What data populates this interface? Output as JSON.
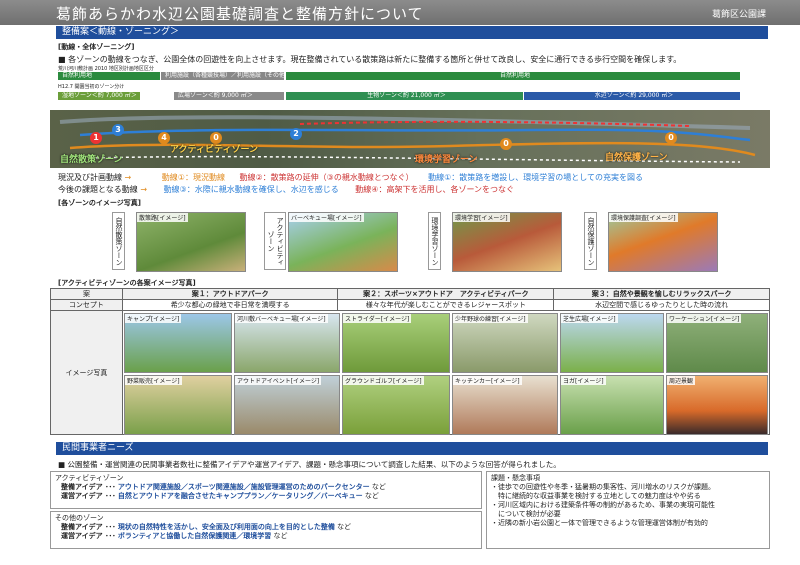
{
  "header": {
    "title": "葛飾あらかわ水辺公園基礎調査と整備方針について",
    "org": "葛飾区公園課"
  },
  "sec1": {
    "title": "整備案＜動線・ゾーニング＞",
    "sub": "[動線・全体ゾーニング]",
    "desc": "■ 各ゾーンの動線をつなぎ、公園全体の回遊性を向上させます。現在整備されている散策路は新たに整備する箇所と併せて改良し、安全に通行できる歩行空間を確保します。",
    "plan_label": "荒川河川敷計画 2010 地区別計画地区区分",
    "row1_a": "自然利用地",
    "row1_b": "利用施設（各種競技場）／利用施設（その他）",
    "row1_c": "自然利用地",
    "plan2": "H12.7 開園当初のゾーン分け",
    "zones": [
      {
        "label": "湿地ゾーン＜約 7,000 ㎡＞",
        "color": "#6b9e3a"
      },
      {
        "label": "広場ゾーン＜約 9,000 ㎡＞",
        "color": "#8a8a8a"
      },
      {
        "label": "生物ゾーン＜約 21,000 ㎡＞",
        "color": "#2f8f52"
      },
      {
        "label": "水辺ゾーン＜約 29,000 ㎡＞",
        "color": "#2a5aa8"
      }
    ],
    "map_zones": [
      "自然散策ゾーン",
      "アクティビティゾーン",
      "環境学習ゾーン",
      "自然保護ゾーン"
    ],
    "map_marks": [
      "1",
      "2",
      "3",
      "4",
      "0",
      "0",
      "0"
    ],
    "flow": {
      "l1a": "現況及び計画動線",
      "l1b": "→",
      "l1c": "動線①：現況動線",
      "l1d": "動線②：散策路の延伸（③の親水動線とつなぐ）",
      "l1e": "動線①：散策路を増設し、環境学習の場としての充実を図る",
      "l2a": "今後の課題となる動線",
      "l2c": "動線③：水際に親水動線を確保し、水辺を感じる",
      "l2d": "動線④：高架下を活用し、各ゾーンをつなぐ"
    }
  },
  "images": {
    "title": "[各ゾーンのイメージ写真]",
    "items": [
      {
        "zone": "自然散策ゾーン",
        "cap": "散策路[イメージ]"
      },
      {
        "zone": "アクティビティゾーン",
        "cap": "バーベキュー場[イメージ]"
      },
      {
        "zone": "環境学習ゾーン",
        "cap": "環境学習[イメージ]"
      },
      {
        "zone": "自然保護ゾーン",
        "cap": "環境保護調査[イメージ]"
      }
    ]
  },
  "activity": {
    "title": "[アクティビティゾーンの各案イメージ写真]",
    "h_an": "案",
    "h_concept": "コンセプト",
    "h_photo": "イメージ写真",
    "plans": [
      {
        "name": "案１：アウトドアパーク",
        "concept": "希少な都心の緑地で非日常を満喫する"
      },
      {
        "name": "案２：スポーツ×アウトドア　アクティビティパーク",
        "concept": "様々な年代が楽しむことができるレジャースポット"
      },
      {
        "name": "案３：自然や景観を愉しむリラックスパーク",
        "concept": "水辺空間で感じるゆったりとした時の流れ"
      }
    ],
    "photos": [
      "キャンプ[イメージ]",
      "河川敷バーベキュー場[イメージ]",
      "ストライダー[イメージ]",
      "少年野球の練習[イメージ]",
      "芝生広場[イメージ]",
      "ワーケーション[イメージ]",
      "野菜販売[イメージ]",
      "アウトドアイベント[イメージ]",
      "グラウンドゴルフ[イメージ]",
      "キッチンカー[イメージ]",
      "ヨガ[イメージ]",
      "周辺景観"
    ]
  },
  "sec2": {
    "title": "民間事業者ニーズ",
    "desc": "■ 公園整備・運営関連の民間事業者数社に整備アイデアや運営アイデア、課題・懸念事項について調査した結果、以下のような回答が得られました。",
    "a_title": "アクティビティゾーン",
    "a1l": "整備アイデア ･･･",
    "a1": "アウトドア関連施設／スポーツ関連施設／施設管理運営のためのパークセンター",
    "a1n": "など",
    "a2l": "運営アイデア ･･･",
    "a2": "自然とアウトドアを融合させたキャンププラン／ケータリング／バーベキュー",
    "a2n": "など",
    "b_title": "その他のゾーン",
    "b1l": "整備アイデア ･･･",
    "b1": "現状の自然特性を活かし、安全面及び利用面の向上を目的とした整備",
    "b1n": "など",
    "b2l": "運営アイデア ･･･",
    "b2": "ボランティアと協働した自然保護関連／環境学習",
    "b2n": "など",
    "c_title": "課題・懸念事項",
    "c1": "・徒歩での回遊性や冬季・猛暑期の集客性、河川増水のリスクが課題。",
    "c1b": "　特に継続的な収益事業を検討する立地としての魅力度はやや劣る",
    "c2": "・河川区域内における建築条件等の制約があるため、事業の実現可能性",
    "c2b": "　について検討が必要",
    "c3": "・近隣の新小岩公園と一体で管理できるような管理運営体制が有効的"
  }
}
